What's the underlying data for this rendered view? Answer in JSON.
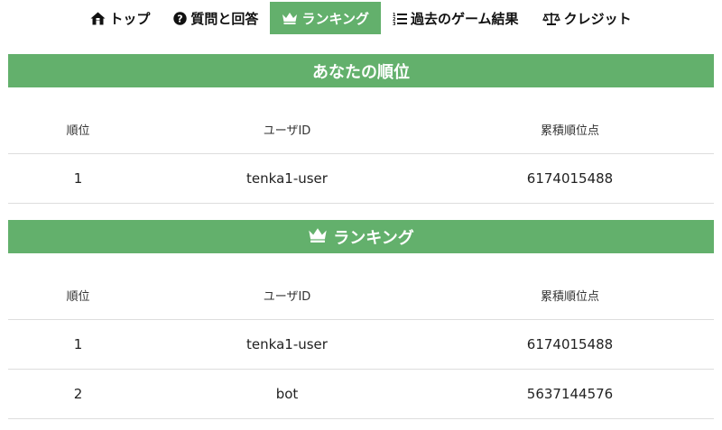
{
  "nav": {
    "items": [
      {
        "label": "トップ",
        "icon": "home-icon"
      },
      {
        "label": "質問と回答",
        "icon": "question-circle-icon"
      },
      {
        "label": "ランキング",
        "icon": "crown-icon",
        "active": true
      },
      {
        "label": "過去のゲーム結果",
        "icon": "list-ol-icon"
      },
      {
        "label": "クレジット",
        "icon": "balance-scale-icon"
      }
    ]
  },
  "my_rank": {
    "title": "あなたの順位",
    "columns": [
      "順位",
      "ユーザID",
      "累積順位点"
    ],
    "rows": [
      [
        "1",
        "tenka1-user",
        "6174015488"
      ]
    ]
  },
  "ranking": {
    "title": "ランキング",
    "icon": "crown-icon",
    "columns": [
      "順位",
      "ユーザID",
      "累積順位点"
    ],
    "rows": [
      [
        "1",
        "tenka1-user",
        "6174015488"
      ],
      [
        "2",
        "bot",
        "5637144576"
      ]
    ]
  },
  "colors": {
    "accent": "#63b06c",
    "accent_text": "#ffffff"
  }
}
